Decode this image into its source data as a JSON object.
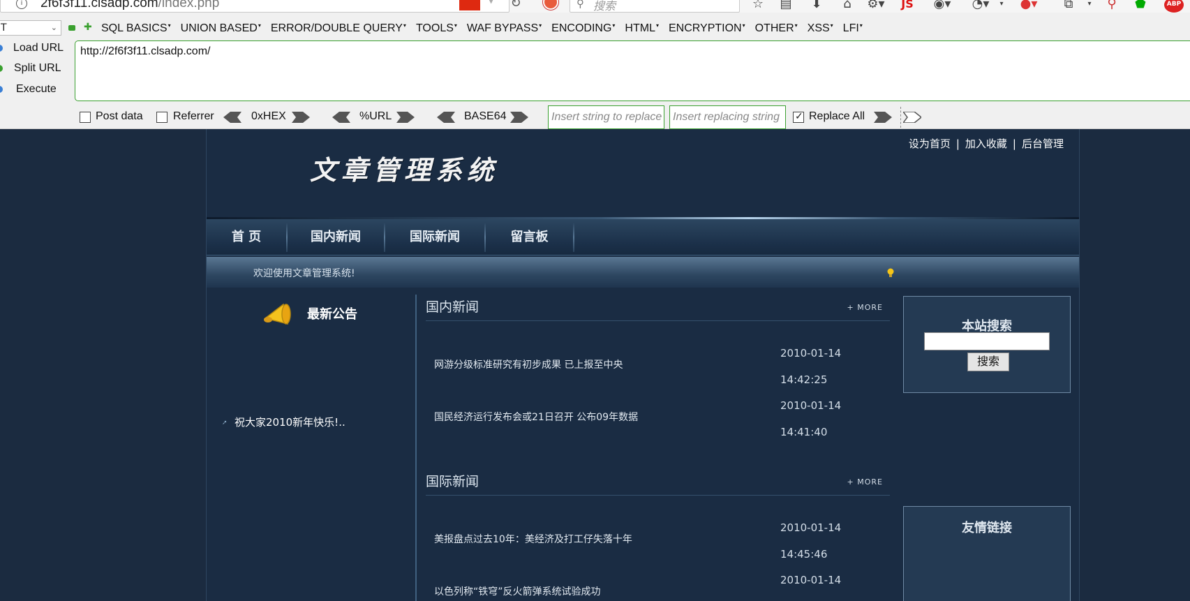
{
  "browser": {
    "url_host": "2f6f3f11.clsadp.com",
    "url_path": "/index.php",
    "search_placeholder": "搜索",
    "js_label": "JS",
    "abp_label": "ABP"
  },
  "hackbar": {
    "select_value": "T",
    "menu": [
      "SQL BASICS",
      "UNION BASED",
      "ERROR/DOUBLE QUERY",
      "TOOLS",
      "WAF BYPASS",
      "ENCODING",
      "HTML",
      "ENCRYPTION",
      "OTHER",
      "XSS",
      "LFI"
    ],
    "load_url": "Load URL",
    "split_url": "Split URL",
    "execute": "Execute",
    "url_value": "http://2f6f3f11.clsadp.com/",
    "post_data": "Post data",
    "referrer": "Referrer",
    "hex": "0xHEX",
    "url_enc": "%URL",
    "base64": "BASE64",
    "replace_from_placeholder": "Insert string to replace",
    "replace_to_placeholder": "Insert replacing string",
    "replace_all": "Replace All"
  },
  "site": {
    "top_links": [
      "设为首页",
      "加入收藏",
      "后台管理"
    ],
    "logo_title": "文章管理系统",
    "nav": [
      "首 页",
      "国内新闻",
      "国际新闻",
      "留言板"
    ],
    "welcome": "欢迎使用文章管理系统!",
    "announce": {
      "title": "最新公告",
      "items": [
        "祝大家2010新年快乐!.."
      ]
    },
    "more_label": "+ MORE",
    "domestic": {
      "title": "国内新闻",
      "items": [
        {
          "title": "网游分级标准研究有初步成果 已上报至中央",
          "date": "2010-01-14",
          "time": "14:42:25"
        },
        {
          "title": "国民经济运行发布会或21日召开 公布09年数据",
          "date": "2010-01-14",
          "time": "14:41:40"
        }
      ]
    },
    "international": {
      "title": "国际新闻",
      "items": [
        {
          "title": "美报盘点过去10年：美经济及打工仔失落十年",
          "date": "2010-01-14",
          "time": "14:45:46"
        },
        {
          "title": "以色列称“铁穹”反火箭弹系统试验成功",
          "date": "2010-01-14",
          "time": ""
        }
      ]
    },
    "search_box": {
      "title": "本站搜索",
      "button": "搜索"
    },
    "links_box": {
      "title": "友情链接"
    }
  }
}
